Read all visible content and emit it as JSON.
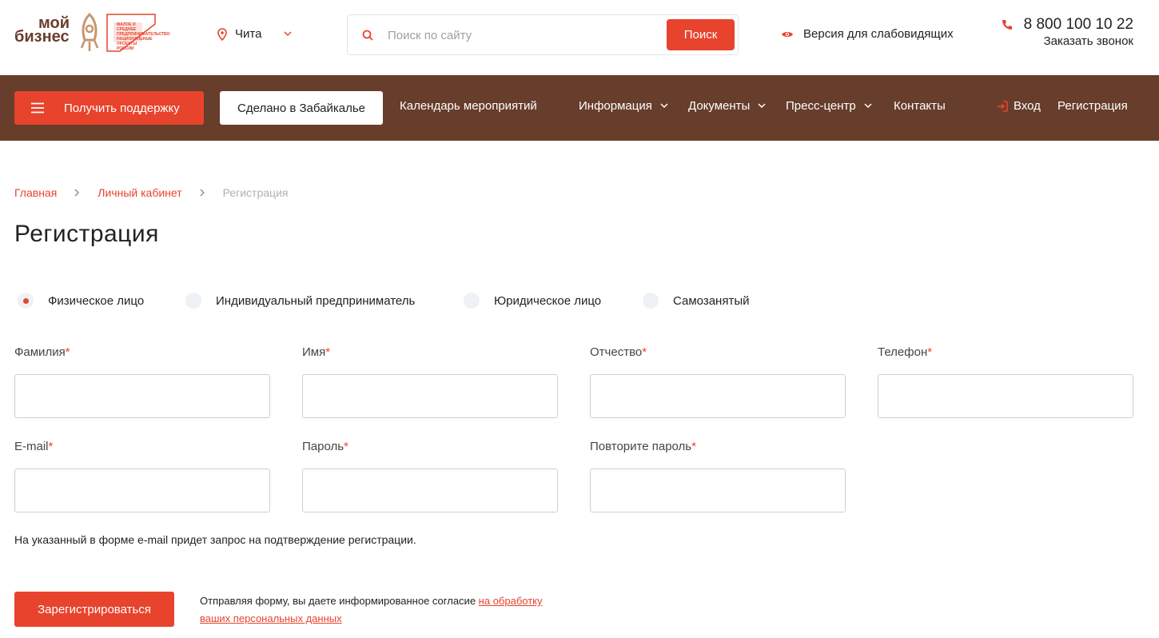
{
  "logo": {
    "line1": "мой",
    "line2": "бизнес",
    "np_text": "МАЛОЕ И СРЕДНЕЕ ПРЕДПРИНИМАТЕЛЬСТВО НАЦИОНАЛЬНЫЕ ПРОЕКТЫ РОССИИ"
  },
  "header": {
    "city": "Чита",
    "search_placeholder": "Поиск по сайту",
    "search_button": "Поиск",
    "vision_label": "Версия для слабовидящих",
    "phone": "8 800 100 10 22",
    "callback": "Заказать звонок"
  },
  "nav": {
    "support": "Получить поддержку",
    "made_in": "Сделано в Забайкалье",
    "calendar": "Календарь мероприятий",
    "info": "Информация",
    "docs": "Документы",
    "press": "Пресс-центр",
    "contacts": "Контакты",
    "login": "Вход",
    "register": "Регистрация"
  },
  "breadcrumbs": {
    "home": "Главная",
    "cabinet": "Личный кабинет",
    "current": "Регистрация"
  },
  "page_title": "Регистрация",
  "person_types": {
    "selected": "Физическое лицо",
    "individual": "Физическое лицо",
    "entrepreneur": "Индивидуальный предприниматель",
    "legal": "Юридическое лицо",
    "selfemployed": "Самозанятый"
  },
  "form": {
    "lastname": "Фамилия",
    "firstname": "Имя",
    "middlename": "Отчество",
    "phone": "Телефон",
    "email": "E-mail",
    "password": "Пароль",
    "password_repeat": "Повторите пароль",
    "required_mark": "*",
    "lastname_value": "",
    "firstname_value": "",
    "middlename_value": "",
    "phone_value": "",
    "email_value": "",
    "password_value": "",
    "password_repeat_value": ""
  },
  "note": "На указанный в форме e-mail придет запрос на подтверждение регистрации.",
  "submit_label": "Зарегистрироваться",
  "consent": {
    "text": "Отправляя форму, вы даете информированное согласие ",
    "link": "на обработку ваших персональных данных"
  },
  "colors": {
    "accent": "#e8432d",
    "nav_bg": "#673d2b",
    "brand_brown": "#6a3d2b"
  }
}
